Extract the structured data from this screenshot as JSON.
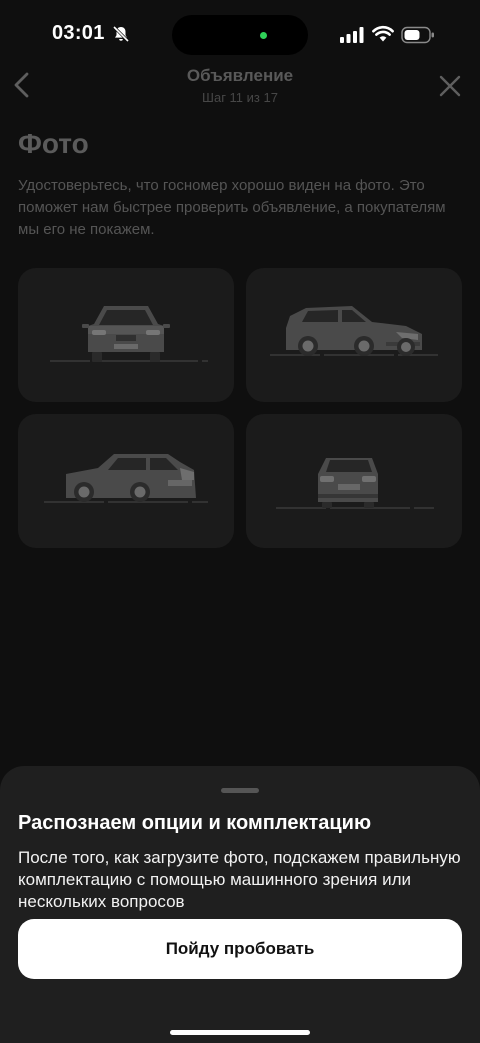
{
  "status_bar": {
    "time": "03:01",
    "icons": [
      "bell-slash-icon",
      "cellular-signal-icon",
      "wifi-icon",
      "battery-icon"
    ]
  },
  "header": {
    "title": "Объявление",
    "step": "Шаг 11 из 17",
    "back_icon": "chevron-left-icon",
    "close_icon": "close-icon"
  },
  "main": {
    "title": "Фото",
    "description": "Удостоверьтесь, что госномер хорошо виден на фото. Это поможет нам быстрее проверить объявление, а покупателям мы его не покажем.",
    "photo_slots": [
      {
        "angle": "front",
        "icon": "car-front-icon"
      },
      {
        "angle": "front-right",
        "icon": "car-front-side-icon"
      },
      {
        "angle": "rear-left",
        "icon": "car-rear-side-icon"
      },
      {
        "angle": "rear",
        "icon": "car-rear-icon"
      }
    ]
  },
  "sheet": {
    "title": "Распознаем опции и комплектацию",
    "body": "После того, как загрузите фото, подскажем правильную комплектацию с помощью машинного зрения или нескольких вопросов",
    "button_label": "Пойду пробовать"
  },
  "colors": {
    "background": "#0f0f0f",
    "card": "#1b1b1b",
    "sheet": "#1f1f1f",
    "button": "#ffffff",
    "camera_indicator": "#2fd158"
  }
}
